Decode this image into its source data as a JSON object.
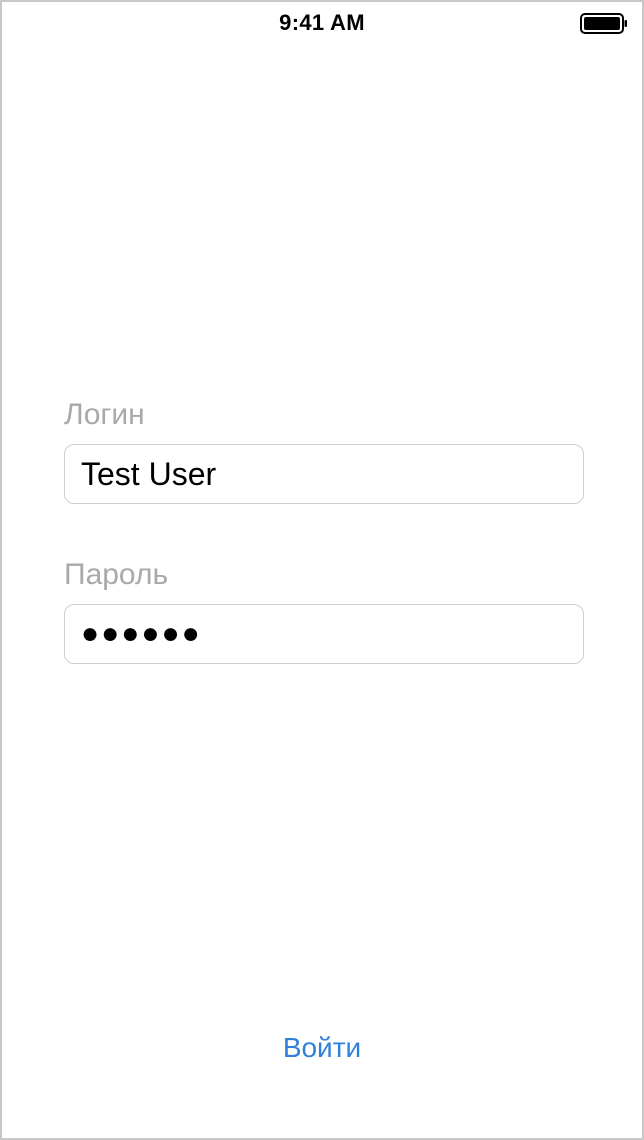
{
  "status_bar": {
    "time": "9:41 AM",
    "battery_icon": "battery-full-icon"
  },
  "form": {
    "login": {
      "label": "Логин",
      "value": "Test User"
    },
    "password": {
      "label": "Пароль",
      "masked_value": "●●●●●●"
    }
  },
  "actions": {
    "submit_label": "Войти"
  },
  "colors": {
    "accent": "#2f7fdb",
    "label_gray": "#a9a9ab",
    "field_border": "#cfcfd3"
  }
}
